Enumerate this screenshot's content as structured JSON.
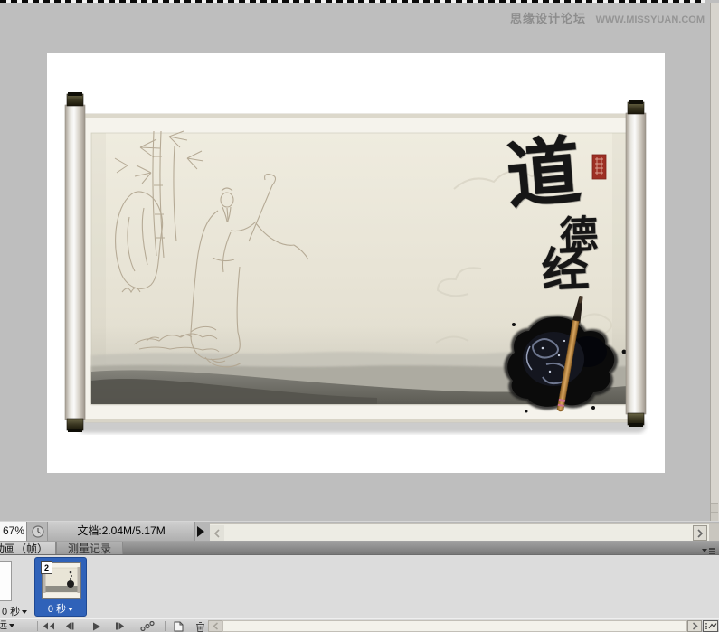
{
  "watermark": {
    "site_name": "思缘设计论坛",
    "site_url": "WWW.MISSYUAN.COM"
  },
  "artwork": {
    "title": "道德经",
    "calligraphy": {
      "c1": "道",
      "c2": "德",
      "c3": "经"
    }
  },
  "status_bar": {
    "zoom_level": "67%",
    "document_info": "文档:2.04M/5.17M"
  },
  "panel_tabs": {
    "animation_tab": "动画（帧）",
    "measurement_tab": "测量记录"
  },
  "timeline": {
    "frame1_delay": "0 秒",
    "frame2_number": "2",
    "frame2_delay": "0 秒",
    "loop_option": "永远"
  },
  "colors": {
    "selection_blue": "#2f62b9",
    "seal_red": "#9e2f24",
    "workspace_gray": "#bebebe",
    "paper_cream": "#e8e4d7"
  }
}
